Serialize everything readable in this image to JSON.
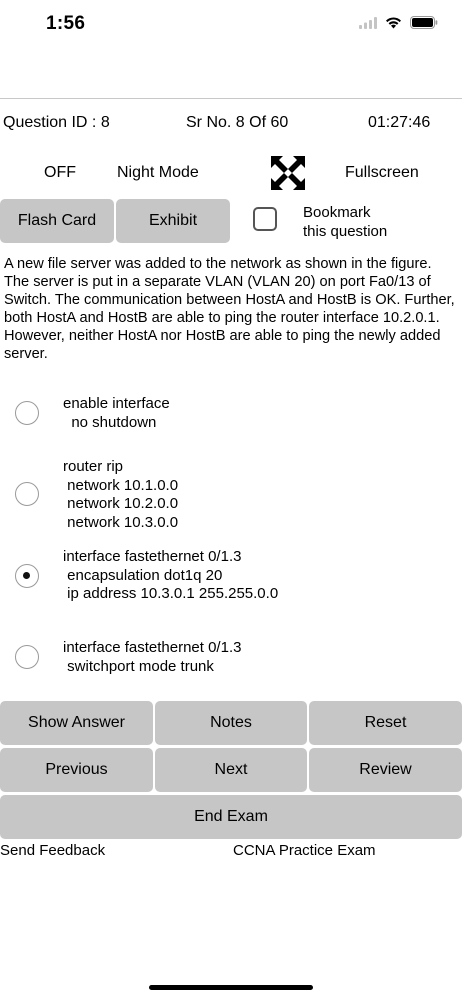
{
  "status_bar": {
    "time": "1:56"
  },
  "header": {
    "question_id": "Question ID : 8",
    "serial": "Sr No. 8 Of 60",
    "timer": "01:27:46"
  },
  "controls": {
    "night_mode_state": "OFF",
    "night_mode_label": "Night Mode",
    "fullscreen_label": "Fullscreen",
    "flash_card_label": "Flash Card",
    "exhibit_label": "Exhibit",
    "bookmark_line1": "Bookmark",
    "bookmark_line2": "this question",
    "bookmark_checked": false
  },
  "question": {
    "text": "A new file server was added to the network as shown in the figure. The server is put in a separate VLAN (VLAN 20) on port Fa0/13 of Switch. The communication between HostA and HostB is OK. Further, both HostA and HostB are able to ping the router interface 10.2.0.1. However, neither HostA nor HostB are able to ping the newly added server."
  },
  "options": [
    {
      "text": "enable interface\n  no shutdown",
      "selected": false
    },
    {
      "text": "router rip\n network 10.1.0.0\n network 10.2.0.0\n network 10.3.0.0",
      "selected": false
    },
    {
      "text": "interface fastethernet 0/1.3\n encapsulation dot1q 20\n ip address 10.3.0.1 255.255.0.0",
      "selected": true
    },
    {
      "text": "interface fastethernet 0/1.3\n switchport mode trunk",
      "selected": false
    }
  ],
  "buttons": {
    "show_answer": "Show Answer",
    "notes": "Notes",
    "reset": "Reset",
    "previous": "Previous",
    "next": "Next",
    "review": "Review",
    "end_exam": "End Exam"
  },
  "footer": {
    "send_feedback": "Send Feedback",
    "app_name": "CCNA Practice Exam"
  },
  "colors": {
    "button_bg": "#c6c6c6",
    "background": "#ffffff"
  }
}
